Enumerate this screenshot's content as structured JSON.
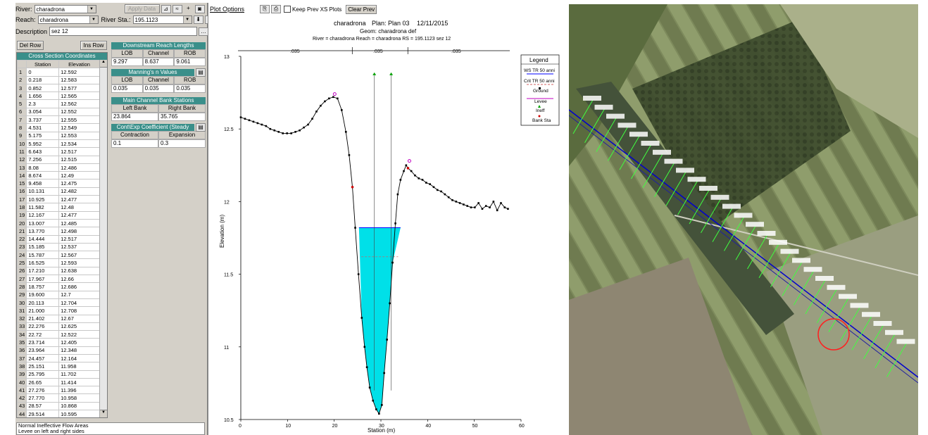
{
  "editor": {
    "river_label": "River:",
    "river_value": "charadrona",
    "apply_data": "Apply Data",
    "reach_label": "Reach:",
    "reach_value": "charadrona",
    "river_sta_label": "River Sta.:",
    "river_sta_value": "195.1123",
    "description_label": "Description",
    "description_value": "sez 12",
    "del_row": "Del Row",
    "ins_row": "Ins Row",
    "xs_caption": "Cross Section Coordinates",
    "col_station": "Station",
    "col_elevation": "Elevation",
    "rows": [
      [
        "1",
        "0",
        "12.592"
      ],
      [
        "2",
        "0.218",
        "12.583"
      ],
      [
        "3",
        "0.852",
        "12.577"
      ],
      [
        "4",
        "1.656",
        "12.565"
      ],
      [
        "5",
        "2.3",
        "12.562"
      ],
      [
        "6",
        "3.054",
        "12.552"
      ],
      [
        "7",
        "3.737",
        "12.555"
      ],
      [
        "8",
        "4.531",
        "12.549"
      ],
      [
        "9",
        "5.175",
        "12.553"
      ],
      [
        "10",
        "5.952",
        "12.534"
      ],
      [
        "11",
        "6.643",
        "12.517"
      ],
      [
        "12",
        "7.256",
        "12.515"
      ],
      [
        "13",
        "8.08",
        "12.486"
      ],
      [
        "14",
        "8.674",
        "12.49"
      ],
      [
        "15",
        "9.458",
        "12.475"
      ],
      [
        "16",
        "10.131",
        "12.482"
      ],
      [
        "17",
        "10.925",
        "12.477"
      ],
      [
        "18",
        "11.582",
        "12.48"
      ],
      [
        "19",
        "12.167",
        "12.477"
      ],
      [
        "20",
        "13.007",
        "12.485"
      ],
      [
        "21",
        "13.770",
        "12.498"
      ],
      [
        "22",
        "14.444",
        "12.517"
      ],
      [
        "23",
        "15.185",
        "12.537"
      ],
      [
        "24",
        "15.787",
        "12.567"
      ],
      [
        "25",
        "16.525",
        "12.593"
      ],
      [
        "26",
        "17.210",
        "12.638"
      ],
      [
        "27",
        "17.967",
        "12.66"
      ],
      [
        "28",
        "18.757",
        "12.686"
      ],
      [
        "29",
        "19.600",
        "12.7"
      ],
      [
        "30",
        "20.113",
        "12.704"
      ],
      [
        "31",
        "21.000",
        "12.708"
      ],
      [
        "32",
        "21.402",
        "12.67"
      ],
      [
        "33",
        "22.276",
        "12.625"
      ],
      [
        "34",
        "22.72",
        "12.522"
      ],
      [
        "35",
        "23.714",
        "12.405"
      ],
      [
        "36",
        "23.964",
        "12.348"
      ],
      [
        "37",
        "24.457",
        "12.164"
      ],
      [
        "38",
        "25.151",
        "11.958"
      ],
      [
        "39",
        "25.795",
        "11.702"
      ],
      [
        "40",
        "26.65",
        "11.414"
      ],
      [
        "41",
        "27.276",
        "11.396"
      ],
      [
        "42",
        "27.770",
        "10.958"
      ],
      [
        "43",
        "28.57",
        "10.868"
      ],
      [
        "44",
        "29.514",
        "10.595"
      ],
      [
        "45",
        "30.70",
        "10.572"
      ],
      [
        "46",
        "31.302",
        "10.581"
      ]
    ],
    "reach_lengths_caption": "Downstream Reach Lengths",
    "rl_headers": [
      "LOB",
      "Channel",
      "ROB"
    ],
    "rl_values": [
      "9.297",
      "8.637",
      "9.061"
    ],
    "manning_caption": "Manning's n Values",
    "mn_headers": [
      "LOB",
      "Channel",
      "ROB"
    ],
    "mn_values": [
      "0.035",
      "0.035",
      "0.035"
    ],
    "bank_caption": "Main Channel Bank Stations",
    "bank_headers": [
      "Left Bank",
      "Right Bank"
    ],
    "bank_values": [
      "23.864",
      "35.765"
    ],
    "coef_caption": "Cont\\Exp Coefficient (Steady Flow)",
    "coef_headers": [
      "Contraction",
      "Expansion"
    ],
    "coef_values": [
      "0.1",
      "0.3"
    ],
    "notes_line1": "Normal Ineffective Flow Areas",
    "notes_line2": "Levee on left and right sides"
  },
  "plot_toolbar": {
    "plot_options": "Plot Options",
    "keep_prev": "Keep Prev XS Plots",
    "clear_prev": "Clear Prev"
  },
  "plot": {
    "title1": "charadrona",
    "title2": "Plan: Plan 03",
    "title3": "12/11/2015",
    "subtitle": "Geom: charadrona def",
    "subtitle2": "River = charadrona   Reach = charadrona   RS = 195.1123   sez 12",
    "ylabel": "Elevation (m)",
    "xlabel": "Station (m)",
    "n_left": ".035",
    "n_chan": ".035",
    "n_right": ".035",
    "legend_title": "Legend",
    "legend_items": [
      "WS TR 50 anni",
      "Crit TR 50 anni",
      "Ground",
      "Levee",
      "Ineff",
      "Bank Sta"
    ]
  },
  "chart_data": {
    "type": "line",
    "xlim": [
      0,
      60
    ],
    "ylim": [
      10.5,
      13.0
    ],
    "xticks": [
      0,
      10,
      20,
      30,
      40,
      50,
      60
    ],
    "yticks": [
      10.5,
      11.0,
      11.5,
      12.0,
      12.5,
      13.0
    ],
    "ground_x": [
      0,
      0.9,
      1.8,
      2.7,
      3.6,
      4.5,
      5.4,
      6.3,
      7.2,
      8.1,
      9.0,
      9.9,
      10.8,
      11.7,
      12.6,
      13.5,
      14.4,
      15.3,
      16.2,
      17.1,
      18.0,
      18.9,
      19.8,
      20.7,
      21.6,
      22.5,
      23.2,
      23.9,
      24.5,
      25.2,
      25.9,
      26.5,
      27.0,
      27.6,
      28.3,
      29.0,
      29.6,
      30.2,
      30.7,
      31.3,
      31.9,
      32.5,
      33.1,
      33.6,
      34.2,
      34.9,
      35.4,
      35.8,
      36.5,
      37.3,
      38.1,
      38.9,
      39.7,
      40.5,
      41.3,
      42.1,
      42.9,
      43.7,
      44.5,
      45.3,
      46.1,
      46.9,
      47.7,
      48.5,
      49.3,
      50.1,
      50.9,
      51.7,
      52.5,
      53.3,
      54.1,
      54.9,
      55.7,
      56.5,
      57.2
    ],
    "ground_y": [
      12.58,
      12.57,
      12.56,
      12.55,
      12.54,
      12.53,
      12.52,
      12.5,
      12.49,
      12.48,
      12.47,
      12.47,
      12.47,
      12.48,
      12.49,
      12.51,
      12.53,
      12.57,
      12.62,
      12.66,
      12.69,
      12.71,
      12.72,
      12.71,
      12.63,
      12.48,
      12.32,
      12.1,
      11.82,
      11.5,
      11.2,
      11.0,
      10.86,
      10.72,
      10.63,
      10.57,
      10.54,
      10.6,
      10.82,
      11.05,
      11.3,
      11.58,
      11.85,
      12.05,
      12.15,
      12.21,
      12.25,
      12.23,
      12.21,
      12.18,
      12.16,
      12.15,
      12.13,
      12.12,
      12.1,
      12.08,
      12.07,
      12.05,
      12.03,
      12.01,
      12.0,
      11.99,
      11.98,
      11.97,
      11.96,
      11.96,
      11.99,
      11.95,
      11.97,
      11.96,
      12.0,
      11.94,
      11.99,
      11.96,
      11.95
    ],
    "ws_elevation": 11.82,
    "ws_x": [
      25.3,
      34.2
    ],
    "crit_elevation": 11.62,
    "bank_stations": [
      23.864,
      35.765
    ],
    "ineff_x": [
      28.6,
      32.2
    ],
    "ineff_y": 12.87,
    "n_breaks": [
      23.864,
      35.765
    ]
  }
}
